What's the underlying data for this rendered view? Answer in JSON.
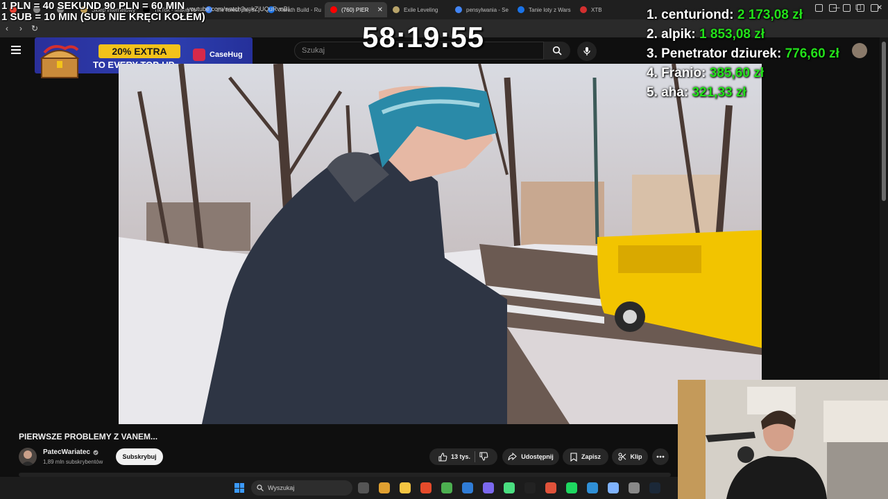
{
  "browser": {
    "tabs": [
      {
        "label": "",
        "color": "#ea4335"
      },
      {
        "label": "",
        "color": "#888888"
      },
      {
        "label": "",
        "color": "#888888"
      },
      {
        "label": "Sklep internetowy",
        "color": "#c9a55a"
      },
      {
        "label": "TikTok - Make Yo",
        "color": "#000000"
      },
      {
        "label": "the forest playth",
        "color": "#4285f4"
      },
      {
        "label": "Xerath Build - Ru",
        "color": "#1a73e8"
      },
      {
        "label": "(760) PIER",
        "color": "#ff0000",
        "active": true
      },
      {
        "label": "Exile Leveling",
        "color": "#b7a36a"
      },
      {
        "label": "pensylwania - Se",
        "color": "#4285f4"
      },
      {
        "label": "Tanie loty z Wars",
        "color": "#1a73e8"
      },
      {
        "label": "XTB",
        "color": "#d32f2f"
      }
    ],
    "url": "youtube.com/watch?v=kZjUQuRvnBI"
  },
  "youtube": {
    "search_placeholder": "Szukaj"
  },
  "ad": {
    "badge": "20% EXTRA",
    "subline": "TO EVERY TOP-UP",
    "brand": "CaseHug"
  },
  "stream_overlay": {
    "rates_line1": "1 PLN =  40 SEKUND 90 PLN = 60 MIN",
    "rates_line2": "1 SUB = 10 MIN (SUB NIE KRĘCI KOŁEM)",
    "timer": "58:19:55",
    "leaderboard": [
      {
        "rank_name": "1. centuriond:",
        "amount": "2 173,08 zł"
      },
      {
        "rank_name": "2. alpik:",
        "amount": "1 853,08 zł"
      },
      {
        "rank_name": "3. Penetrator dziurek:",
        "amount": "776,60 zł"
      },
      {
        "rank_name": "4. Franio:",
        "amount": "385,60 zł"
      },
      {
        "rank_name": "5. aha:",
        "amount": "321,33 zł"
      }
    ]
  },
  "video": {
    "title": "PIERWSZE PROBLEMY Z VANEM...",
    "channel": "PatecWariatec",
    "subscribers": "1,89 mln subskrybentów",
    "subscribe_label": "Subskrybuj",
    "likes": "13 tys.",
    "share_label": "Udostępnij",
    "save_label": "Zapisz",
    "clip_label": "Klip"
  },
  "taskbar": {
    "search_label": "Wyszukaj",
    "app_colors": [
      "#555555",
      "#e0a030",
      "#f5c542",
      "#e54b2b",
      "#4caf50",
      "#2f7cd6",
      "#7b68ee",
      "#4ade80",
      "#222222",
      "#e0523a",
      "#1ed760",
      "#2f8fd6",
      "#7fb3ff",
      "#888888",
      "#1b2838"
    ]
  }
}
